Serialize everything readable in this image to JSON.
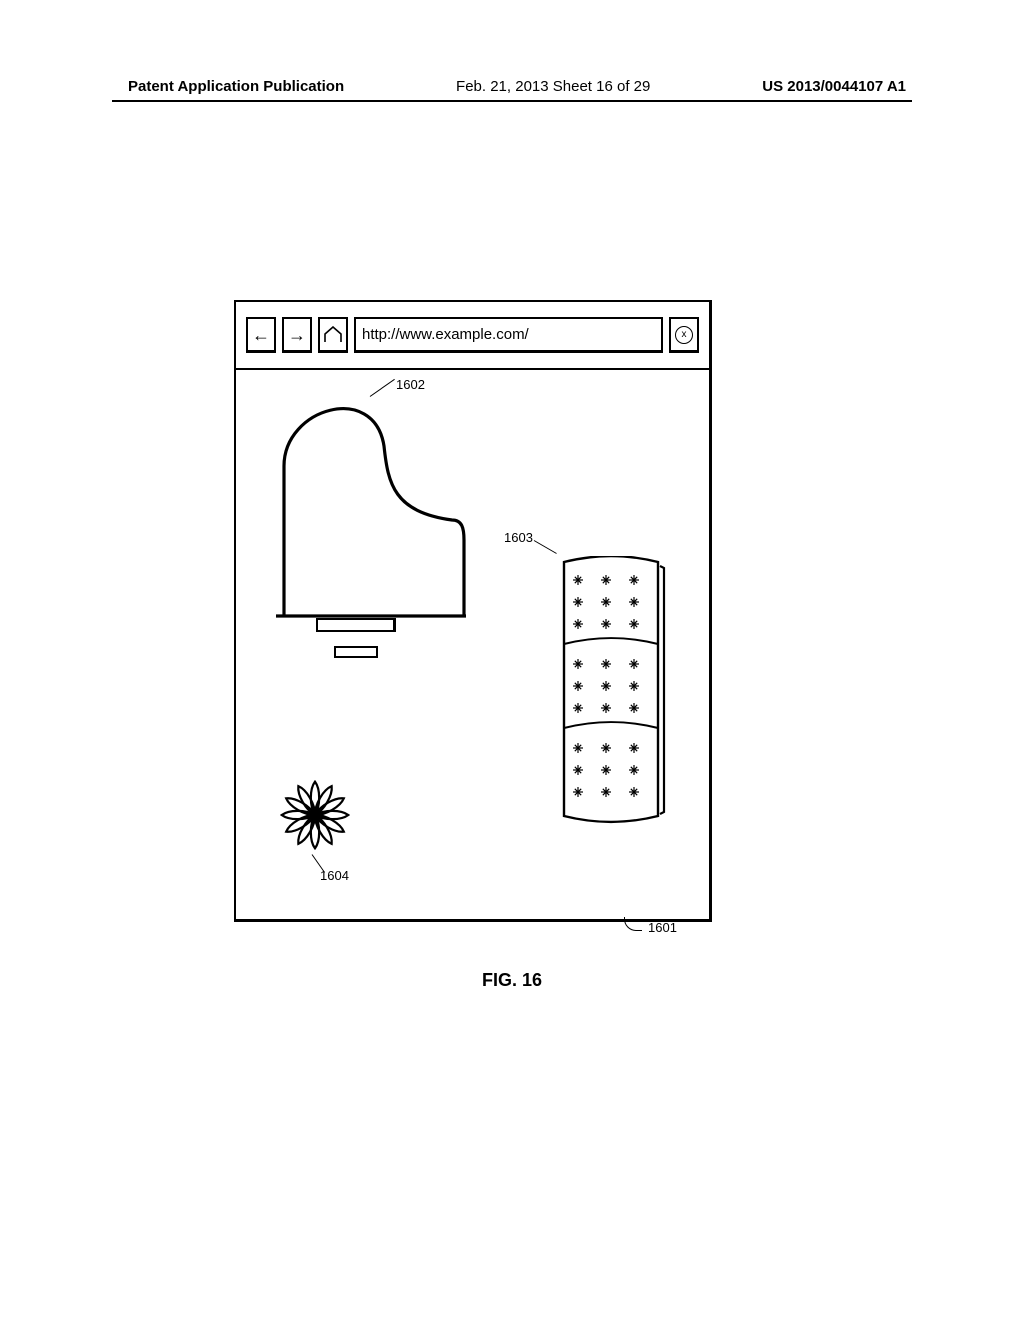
{
  "header": {
    "left": "Patent Application Publication",
    "mid": "Feb. 21, 2013   Sheet 16 of 29",
    "right": "US 2013/0044107 A1"
  },
  "browser": {
    "url": "http://www.example.com/",
    "stop_label": "x"
  },
  "refs": {
    "r1601": "1601",
    "r1602": "1602",
    "r1603": "1603",
    "r1604": "1604"
  },
  "caption": "FIG. 16"
}
